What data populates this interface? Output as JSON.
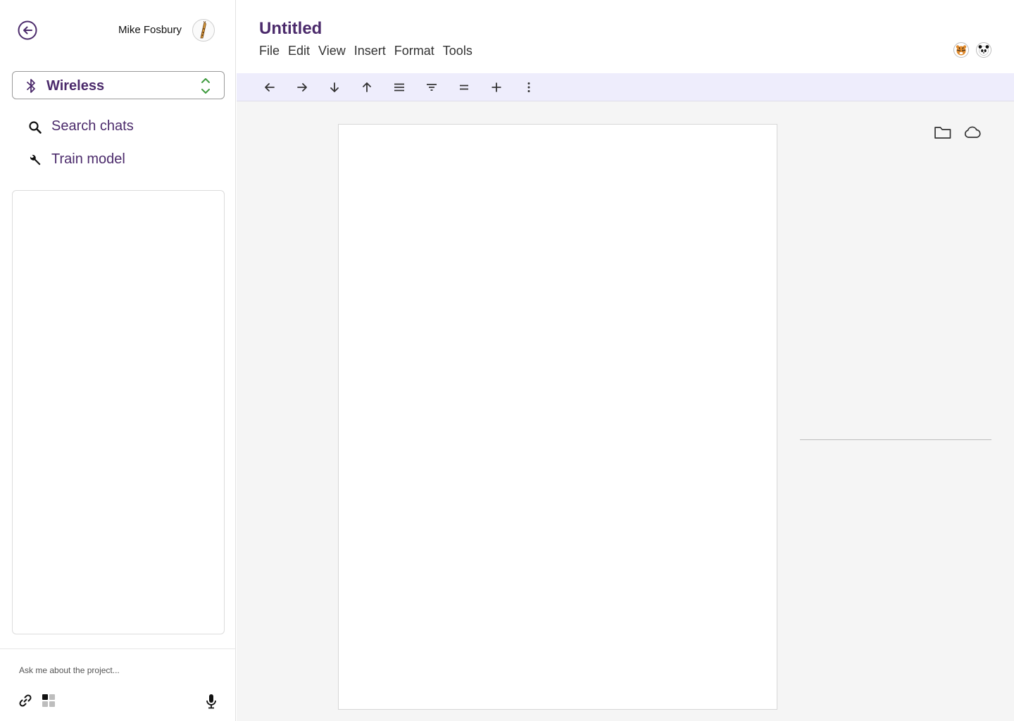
{
  "user": {
    "name": "Mike Fosbury",
    "avatar_icon": "giraffe-avatar-icon"
  },
  "project_selector": {
    "value": "Wireless",
    "icon": "bluetooth-icon",
    "accent": "#4b2a6b",
    "arrow_color": "#3f9b3f"
  },
  "sidebar": {
    "back_icon": "arrow-left-circle-icon",
    "nav": [
      {
        "label": "Search chats",
        "icon": "search-icon"
      },
      {
        "label": "Train model",
        "icon": "wrench-icon"
      }
    ]
  },
  "chat": {
    "placeholder": "Ask me about the project...",
    "icons": [
      "link-icon",
      "widgets-icon",
      "microphone-icon"
    ]
  },
  "document": {
    "title": "Untitled",
    "menu": [
      "File",
      "Edit",
      "View",
      "Insert",
      "Format",
      "Tools"
    ],
    "collaborators": [
      "tiger-avatar-icon",
      "panda-avatar-icon"
    ]
  },
  "toolbar": {
    "buttons": [
      "arrow-left-icon",
      "arrow-right-icon",
      "arrow-down-icon",
      "arrow-up-icon",
      "menu-lines-icon",
      "filter-lines-icon",
      "equals-icon",
      "plus-icon",
      "more-vertical-icon"
    ],
    "background": "#eeedfc"
  },
  "side_panel": {
    "icons": [
      "folder-icon",
      "cloud-icon"
    ]
  }
}
